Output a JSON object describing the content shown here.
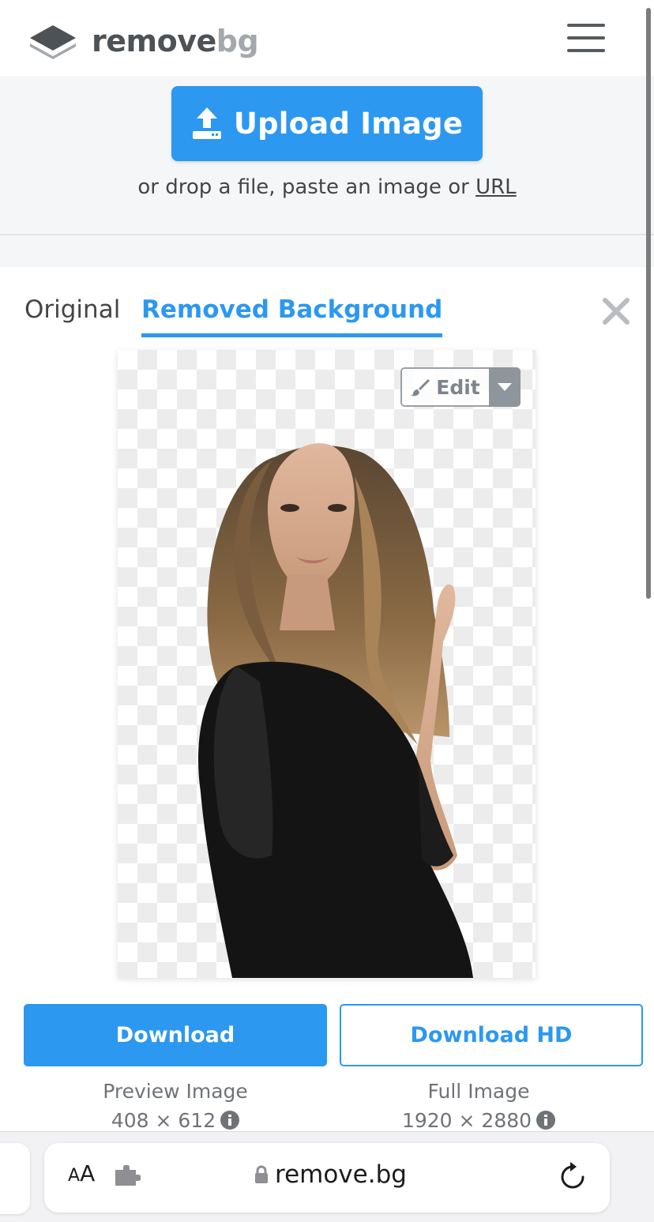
{
  "header": {
    "logo_word1": "remove",
    "logo_word2": "bg",
    "menu_icon": "hamburger-menu-icon"
  },
  "upload": {
    "button_label": "Upload Image",
    "drop_text_prefix": "or drop a file, paste an image or ",
    "url_link": "URL"
  },
  "tabs": [
    {
      "label": "Original",
      "active": false
    },
    {
      "label": "Removed Background",
      "active": true
    }
  ],
  "preview": {
    "edit_label": "Edit"
  },
  "downloads": {
    "download_label": "Download",
    "download_hd_label": "Download HD",
    "preview_caption": "Preview Image",
    "preview_size": "408 × 612",
    "full_caption": "Full Image",
    "full_size": "1920 × 2880"
  },
  "browser": {
    "aa_small": "A",
    "aa_large": "A",
    "url": "remove.bg"
  },
  "colors": {
    "accent": "#2c98f0",
    "logo_dark": "#4d5256",
    "logo_light": "#a3a8ad"
  }
}
